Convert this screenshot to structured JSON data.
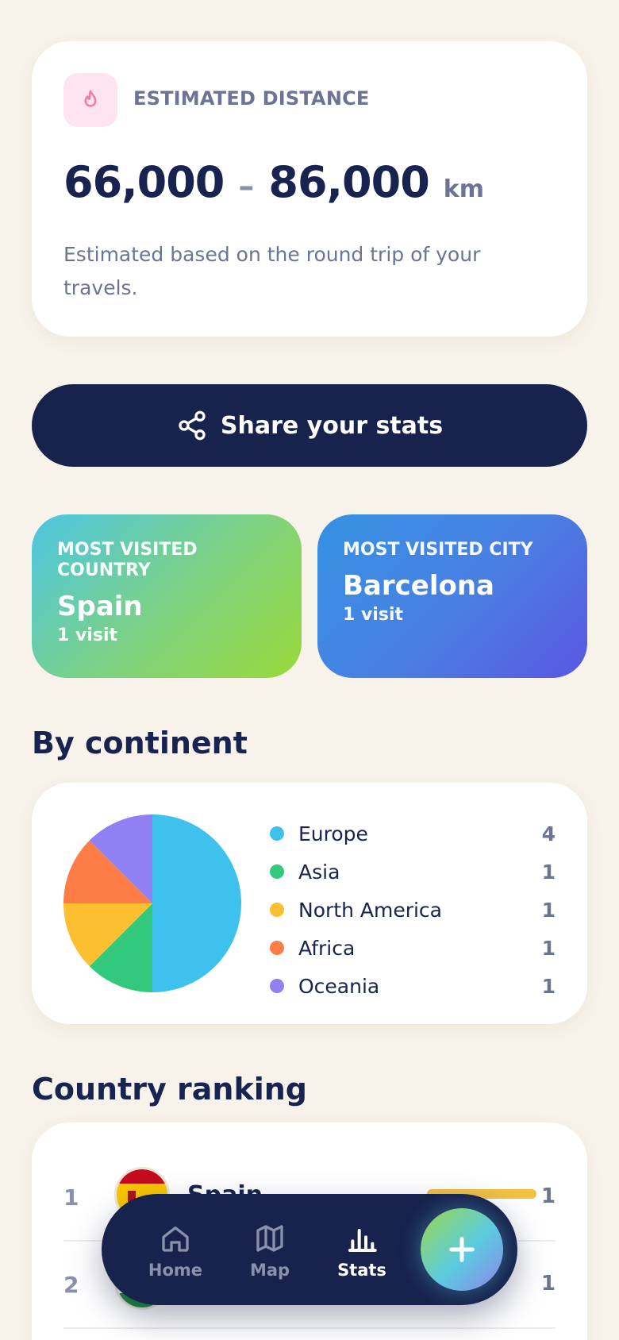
{
  "distance": {
    "label": "ESTIMATED DISTANCE",
    "min": "66,000",
    "separator": "–",
    "max": "86,000",
    "unit": "km",
    "note": "Estimated based on the round trip of your travels.",
    "icon": "flame-icon",
    "icon_bg": "#fde4ee",
    "icon_color": "#f27aa6"
  },
  "share": {
    "label": "Share your stats",
    "icon": "share-icon"
  },
  "most_visited_country": {
    "label": "MOST VISITED COUNTRY",
    "value": "Spain",
    "sub": "1 visit"
  },
  "most_visited_city": {
    "label": "MOST VISITED CITY",
    "value": "Barcelona",
    "sub": "1 visit"
  },
  "by_continent": {
    "title": "By continent",
    "items": [
      {
        "name": "Europe",
        "count": "4",
        "color": "#3ec1ec"
      },
      {
        "name": "Asia",
        "count": "1",
        "color": "#33c97c"
      },
      {
        "name": "North America",
        "count": "1",
        "color": "#fbbf2f"
      },
      {
        "name": "Africa",
        "count": "1",
        "color": "#fe7c46"
      },
      {
        "name": "Oceania",
        "count": "1",
        "color": "#917ff4"
      }
    ]
  },
  "chart_data": {
    "type": "pie",
    "categories": [
      "Europe",
      "Asia",
      "North America",
      "Africa",
      "Oceania"
    ],
    "values": [
      4,
      1,
      1,
      1,
      1
    ],
    "colors": [
      "#3ec1ec",
      "#33c97c",
      "#fbbf2f",
      "#fe7c46",
      "#917ff4"
    ],
    "legend": "right"
  },
  "ranking": {
    "title": "Country ranking",
    "rows": [
      {
        "rank": "1",
        "name": "Spain",
        "count": "1",
        "share": 1.0
      },
      {
        "rank": "2",
        "name": "",
        "count": "1",
        "share": 1.0
      }
    ]
  },
  "nav": {
    "home": "Home",
    "map": "Map",
    "stats": "Stats",
    "active": "stats",
    "add_icon": "plus-icon"
  }
}
